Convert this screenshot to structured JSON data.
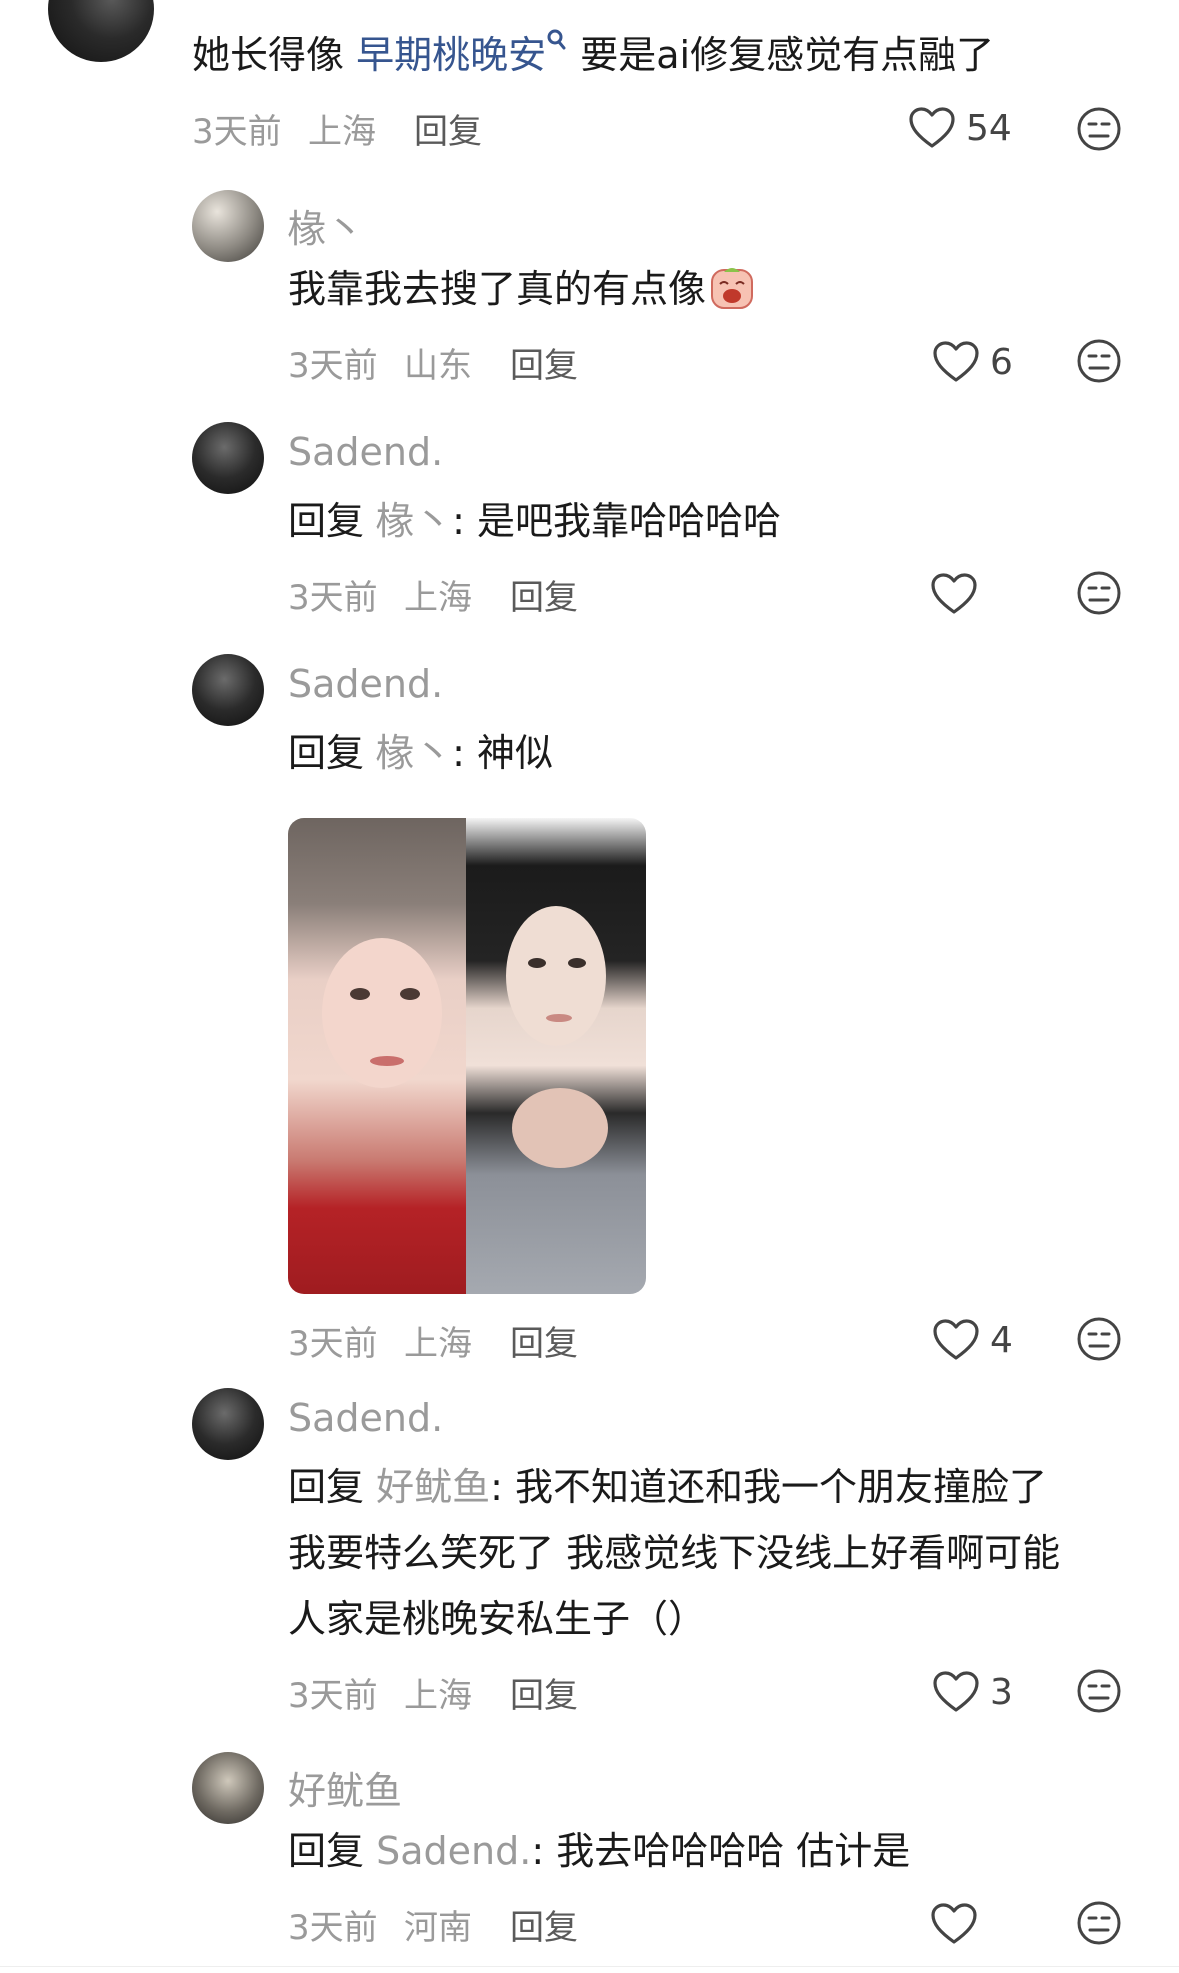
{
  "top_comment": {
    "text_prefix": "她长得像",
    "link_text": "早期桃晚安",
    "text_suffix": "要是ai修复感觉有点融了",
    "time": "3天前",
    "location": "上海",
    "reply_label": "回复",
    "likes": "54"
  },
  "replies": [
    {
      "username": "椽丶",
      "content": "我靠我去搜了真的有点像",
      "emoji": "crying-face-emoji",
      "time": "3天前",
      "location": "山东",
      "reply_label": "回复",
      "likes": "6"
    },
    {
      "username": "Sadend.",
      "reply_prefix": "回复",
      "reply_to": "椽丶",
      "content": ": 是吧我靠哈哈哈哈",
      "time": "3天前",
      "location": "上海",
      "reply_label": "回复",
      "likes": ""
    },
    {
      "username": "Sadend.",
      "reply_prefix": "回复",
      "reply_to": "椽丶",
      "content": ": 神似",
      "time": "3天前",
      "location": "上海",
      "reply_label": "回复",
      "likes": "4"
    },
    {
      "username": "Sadend.",
      "reply_prefix": "回复",
      "reply_to": "好鱿鱼",
      "content_line1": ": 我不知道还和我一个朋友撞脸了",
      "content_line2": "我要特么笑死了 我感觉线下没线上好看啊可能",
      "content_line3": "人家是桃晚安私生子（）",
      "time": "3天前",
      "location": "上海",
      "reply_label": "回复",
      "likes": "3"
    },
    {
      "username": "好鱿鱼",
      "reply_prefix": "回复",
      "reply_to": "Sadend.",
      "content": ": 我去哈哈哈哈 估计是",
      "time": "3天前",
      "location": "河南",
      "reply_label": "回复",
      "likes": ""
    }
  ],
  "icons": {
    "like": "heart-outline-icon",
    "dislike": "neutral-face-icon",
    "search_hint": "search-icon"
  },
  "colors": {
    "link": "#36558f",
    "secondary_text": "#9a9a9a",
    "primary_text": "#1a1a1a"
  }
}
